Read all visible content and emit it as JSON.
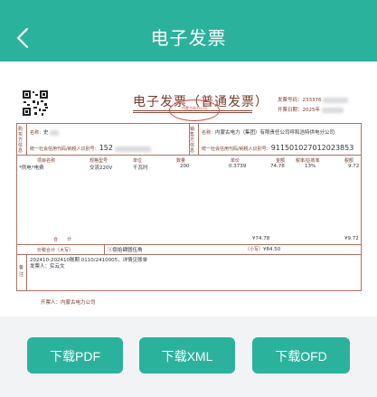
{
  "header": {
    "title": "电子发票"
  },
  "invoice": {
    "title": "电子发票（普通发票）",
    "seal_text": "内蒙古电力公司",
    "invoice_no_label": "发票号码：",
    "invoice_no_visible": "233376",
    "issue_date_label": "开票日期：",
    "issue_date_visible": "2025年",
    "buyer": {
      "side_label": "购买方信息",
      "name_label": "名称：",
      "name_value": "史",
      "tax_label": "统一社会信用代码/纳税人识别号：",
      "tax_value": "152"
    },
    "seller": {
      "side_label": "销售方信息",
      "name_label": "名称：",
      "name_value": "内蒙古电力（集团）有限责任公司呼和浩特供电分公司",
      "tax_label": "统一社会信用代码/纳税人识别号：",
      "tax_value": "911501027012023853"
    },
    "columns": [
      "项目名称",
      "规格型号",
      "单位",
      "数量",
      "单价",
      "金额",
      "税率/征收率",
      "税额"
    ],
    "rows": [
      {
        "name": "*供电*电费",
        "spec": "交流220V",
        "unit": "千瓦时",
        "qty": "200",
        "price": "0.3739",
        "amount": "74.78",
        "rate": "13%",
        "tax": "9.72"
      }
    ],
    "total": {
      "label": "合　　计",
      "amount": "¥74.78",
      "tax": "¥9.72"
    },
    "grand_total": {
      "label": "价税合计（大写）",
      "upper_prefix": "ⓧ",
      "upper_value": "捌拾肆圆伍角",
      "lower_label": "（小写）",
      "lower_value": "¥84.50"
    },
    "remark": {
      "label": "备注",
      "line1": "202410-202410账期 0110/2410005，详情见账单",
      "line2": "发票人：实云文"
    },
    "issuer_label": "开票人：",
    "issuer_value": "内蒙古电力公司"
  },
  "actions": {
    "pdf": "下载PDF",
    "xml": "下载XML",
    "ofd": "下载OFD"
  },
  "colors": {
    "primary": "#2bb29d",
    "invoice_text": "#7a3a2a",
    "seal": "#d64545"
  }
}
